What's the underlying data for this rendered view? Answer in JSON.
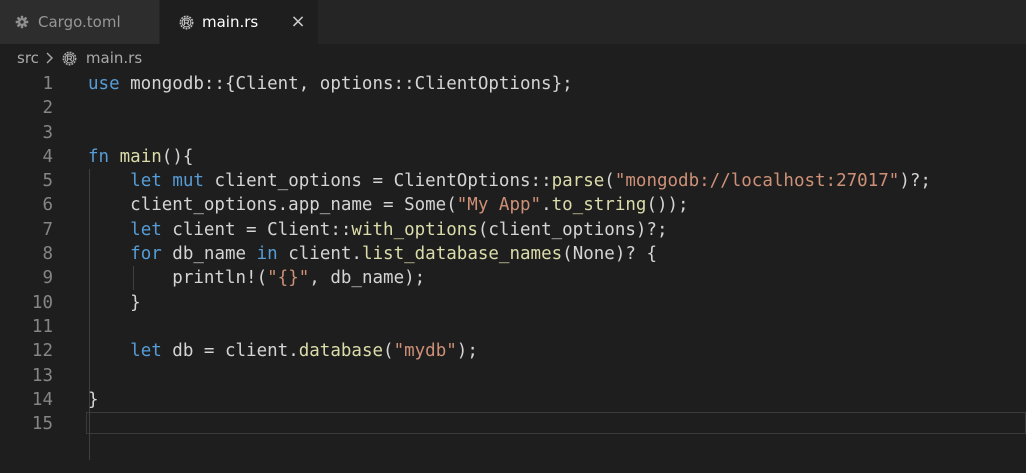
{
  "tabs": [
    {
      "label": "Cargo.toml",
      "icon": "gear-icon",
      "active": false
    },
    {
      "label": "main.rs",
      "icon": "rust-icon",
      "active": true,
      "close": "×"
    }
  ],
  "breadcrumb": {
    "folder": "src",
    "file": "main.rs"
  },
  "editor": {
    "line_numbers": [
      "1",
      "2",
      "3",
      "4",
      "5",
      "6",
      "7",
      "8",
      "9",
      "10",
      "11",
      "12",
      "13",
      "14",
      "15"
    ],
    "colors": {
      "keyword": "#569cd6",
      "function": "#dcdcaa",
      "string": "#ce9178",
      "text": "#d4d4d4",
      "line_number": "#858585",
      "background": "#1e1e1e"
    },
    "lines": [
      [
        {
          "t": "use",
          "c": "kw"
        },
        {
          "t": " mongodb::{Client, options::ClientOptions};"
        }
      ],
      [],
      [],
      [
        {
          "t": "fn",
          "c": "kw"
        },
        {
          "t": " "
        },
        {
          "t": "main",
          "c": "fn"
        },
        {
          "t": "(){"
        }
      ],
      [
        {
          "t": "    "
        },
        {
          "t": "let",
          "c": "kw"
        },
        {
          "t": " "
        },
        {
          "t": "mut",
          "c": "kw"
        },
        {
          "t": " client_options = ClientOptions::"
        },
        {
          "t": "parse",
          "c": "fn"
        },
        {
          "t": "("
        },
        {
          "t": "\"mongodb://localhost:27017\"",
          "c": "str"
        },
        {
          "t": ")?;"
        }
      ],
      [
        {
          "t": "    client_options.app_name = Some("
        },
        {
          "t": "\"My App\"",
          "c": "str"
        },
        {
          "t": "."
        },
        {
          "t": "to_string",
          "c": "fn"
        },
        {
          "t": "());"
        }
      ],
      [
        {
          "t": "    "
        },
        {
          "t": "let",
          "c": "kw"
        },
        {
          "t": " client = Client::"
        },
        {
          "t": "with_options",
          "c": "fn"
        },
        {
          "t": "(client_options)?;"
        }
      ],
      [
        {
          "t": "    "
        },
        {
          "t": "for",
          "c": "kw"
        },
        {
          "t": " db_name "
        },
        {
          "t": "in",
          "c": "kw"
        },
        {
          "t": " client."
        },
        {
          "t": "list_database_names",
          "c": "fn"
        },
        {
          "t": "(None)? {"
        }
      ],
      [
        {
          "t": "        println!("
        },
        {
          "t": "\"{}\"",
          "c": "str"
        },
        {
          "t": ", db_name);"
        }
      ],
      [
        {
          "t": "    }"
        }
      ],
      [],
      [
        {
          "t": "    "
        },
        {
          "t": "let",
          "c": "kw"
        },
        {
          "t": " db = client."
        },
        {
          "t": "database",
          "c": "fn"
        },
        {
          "t": "("
        },
        {
          "t": "\"mydb\"",
          "c": "str"
        },
        {
          "t": ");"
        }
      ],
      [],
      [
        {
          "t": "}"
        }
      ],
      []
    ]
  }
}
